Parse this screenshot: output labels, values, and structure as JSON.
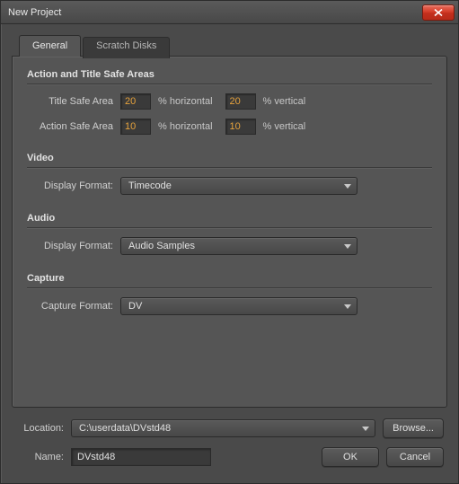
{
  "window": {
    "title": "New Project"
  },
  "tabs": {
    "general": "General",
    "scratch": "Scratch Disks"
  },
  "groups": {
    "safeAreas": {
      "title": "Action and Title Safe Areas",
      "titleSafe": {
        "label": "Title Safe Area",
        "h": "20",
        "v": "20"
      },
      "actionSafe": {
        "label": "Action Safe Area",
        "h": "10",
        "v": "10"
      },
      "hUnit": "% horizontal",
      "vUnit": "% vertical"
    },
    "video": {
      "title": "Video",
      "displayFormatLabel": "Display Format:",
      "displayFormatValue": "Timecode"
    },
    "audio": {
      "title": "Audio",
      "displayFormatLabel": "Display Format:",
      "displayFormatValue": "Audio Samples"
    },
    "capture": {
      "title": "Capture",
      "captureFormatLabel": "Capture Format:",
      "captureFormatValue": "DV"
    }
  },
  "footer": {
    "locationLabel": "Location:",
    "locationValue": "C:\\userdata\\DVstd48",
    "browse": "Browse...",
    "nameLabel": "Name:",
    "nameValue": "DVstd48",
    "ok": "OK",
    "cancel": "Cancel"
  }
}
